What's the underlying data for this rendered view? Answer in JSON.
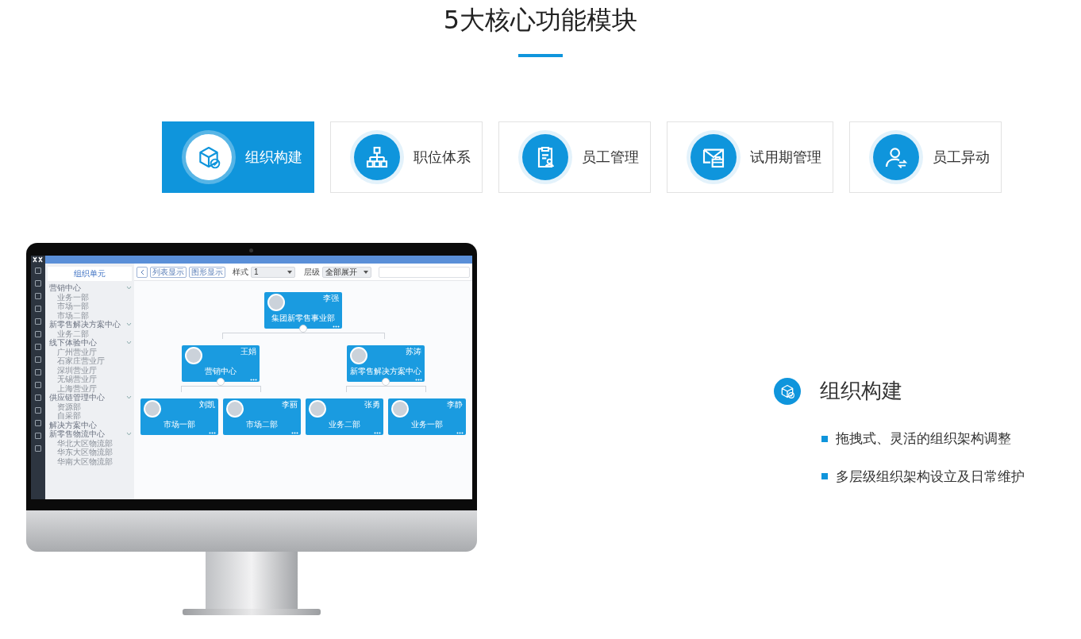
{
  "title": "5大核心功能模块",
  "tabs": [
    {
      "label": "组织构建",
      "selected": true
    },
    {
      "label": "职位体系",
      "selected": false
    },
    {
      "label": "员工管理",
      "selected": false
    },
    {
      "label": "试用期管理",
      "selected": false
    },
    {
      "label": "员工异动",
      "selected": false
    }
  ],
  "screen": {
    "sidebar_title": "组织单元",
    "tree": [
      {
        "label": "营销中心",
        "expanded": true,
        "children": [
          {
            "label": "业务一部"
          },
          {
            "label": "市场一部"
          },
          {
            "label": "市场二部"
          }
        ]
      },
      {
        "label": "新零售解决方案中心",
        "expanded": true,
        "children": [
          {
            "label": "业务二部"
          }
        ]
      },
      {
        "label": "线下体验中心",
        "expanded": true,
        "children": [
          {
            "label": "广州营业厅"
          },
          {
            "label": "石家庄营业厅"
          },
          {
            "label": "深圳营业厅"
          },
          {
            "label": "无锡营业厅"
          },
          {
            "label": "上海营业厅"
          }
        ]
      },
      {
        "label": "供应链管理中心",
        "expanded": true,
        "children": [
          {
            "label": "资源部"
          },
          {
            "label": "自采部"
          }
        ]
      },
      {
        "label": "解决方案中心"
      },
      {
        "label": "新零售物流中心",
        "expanded": true,
        "children": [
          {
            "label": "华北大区物流部"
          },
          {
            "label": "华东大区物流部"
          },
          {
            "label": "华南大区物流部"
          }
        ]
      }
    ],
    "toolbar": {
      "buttons": [
        "列表显示",
        "图形显示"
      ],
      "style_label": "样式",
      "style_value": "1",
      "level_label": "层级",
      "level_value": "全部展开"
    },
    "org_chart": {
      "name": "集团新零售事业部",
      "person": "李强",
      "children": [
        {
          "name": "营销中心",
          "person": "王娟",
          "children": [
            {
              "name": "市场一部",
              "person": "刘凯"
            },
            {
              "name": "市场二部",
              "person": "李丽"
            }
          ]
        },
        {
          "name": "新零售解决方案中心",
          "person": "苏涛",
          "children": [
            {
              "name": "业务二部",
              "person": "张勇"
            },
            {
              "name": "业务一部",
              "person": "李静"
            }
          ]
        }
      ]
    }
  },
  "feature": {
    "title": "组织构建",
    "points": [
      "拖拽式、灵活的组织架构调整",
      "多层级组织架构设立及日常维护"
    ]
  }
}
